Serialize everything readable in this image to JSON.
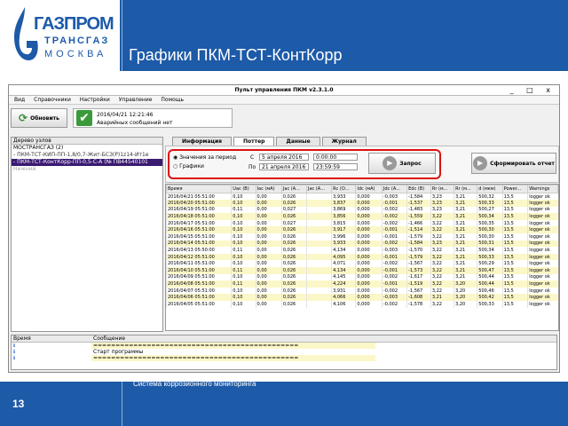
{
  "header": {
    "logo_main": "ГАЗПРОМ",
    "logo_sub1": "ТРАНСГАЗ",
    "logo_sub2": "МОСКВА",
    "slide_title": "Графики ПКМ-ТСТ-КонтКорр"
  },
  "window": {
    "title": "Пульт управления ПКМ v2.3.1.0",
    "controls": "_ □ x"
  },
  "menu": [
    "Вид",
    "Справочники",
    "Настройки",
    "Управление",
    "Помощь"
  ],
  "toolbar": {
    "refresh_label": "Обновить",
    "status_time": "2016/04/21 12:21:46",
    "status_msg": "Аварийных сообщений нет"
  },
  "tree": {
    "header": "Дерево узлов",
    "items": [
      "МОСТРАНСГАЗ (2)",
      "- ПКМ-ТСТ-КИП-ПП-1,8/0,7-Жит-БСЗ(Р)1z14-Ит1е",
      "- ПКМ-ТСТ-КонтКорр-ПП-0,5-С-А (№ ПВ44540101",
      "Нижний"
    ]
  },
  "tabs": [
    "Информация",
    "Поттер",
    "Данные",
    "Журнал"
  ],
  "query": {
    "radio1": "Значения за период",
    "radio2": "Графики",
    "from_label": "С",
    "to_label": "По",
    "from_date": "5  апреля  2016",
    "from_time": "0:00:00",
    "to_date": "21  апреля  2016",
    "to_time": "23:59:59",
    "query_button": "Запрос",
    "report_button": "Сформировать отчет"
  },
  "table": {
    "columns": [
      "Время",
      "Uac (В)",
      "Iac (мА)",
      "Jac (А...",
      "Jac (А...",
      "Rc (О...",
      "Idc (мА)",
      "Jdc (А...",
      "Edc (В)",
      "Rr (м...",
      "Rr (м...",
      "d (мкм)",
      "Power...",
      "Warnings"
    ],
    "rows": [
      [
        "2016/04/21 05:51:00",
        "0,10",
        "0,00",
        "0,026",
        "3,933",
        "0,000",
        "-0,003",
        "-1,584",
        "3,23",
        "3,21",
        "500,32",
        "13,5",
        "logger ok"
      ],
      [
        "2016/04/20 05:51:00",
        "0,10",
        "0,00",
        "0,026",
        "3,837",
        "0,000",
        "-0,001",
        "-1,537",
        "3,23",
        "3,21",
        "500,33",
        "13,5",
        "logger ok"
      ],
      [
        "2016/04/19 05:51:00",
        "0,11",
        "0,00",
        "0,027",
        "3,869",
        "0,000",
        "-0,002",
        "-1,483",
        "3,23",
        "3,21",
        "500,27",
        "13,5",
        "logger ok"
      ],
      [
        "2016/04/18 05:51:00",
        "0,10",
        "0,00",
        "0,026",
        "3,856",
        "0,000",
        "-0,002",
        "-1,559",
        "3,22",
        "3,21",
        "500,34",
        "13,5",
        "logger ok"
      ],
      [
        "2016/04/17 05:51:00",
        "0,10",
        "0,00",
        "0,027",
        "3,815",
        "0,000",
        "-0,002",
        "-1,466",
        "3,22",
        "3,21",
        "500,35",
        "13,5",
        "logger ok"
      ],
      [
        "2016/04/16 05:51:00",
        "0,10",
        "0,00",
        "0,026",
        "3,917",
        "0,000",
        "-0,001",
        "-1,514",
        "3,22",
        "3,21",
        "500,30",
        "13,5",
        "logger ok"
      ],
      [
        "2016/04/15 05:51:00",
        "0,10",
        "0,00",
        "0,026",
        "3,996",
        "0,000",
        "-0,001",
        "-1,579",
        "3,22",
        "3,21",
        "500,30",
        "13,5",
        "logger ok"
      ],
      [
        "2016/04/14 05:51:00",
        "0,10",
        "0,00",
        "0,026",
        "3,933",
        "0,000",
        "-0,002",
        "-1,584",
        "3,23",
        "3,21",
        "500,31",
        "13,5",
        "logger ok"
      ],
      [
        "2016/04/13 05:50:00",
        "0,11",
        "0,00",
        "0,026",
        "4,134",
        "0,000",
        "-0,003",
        "-1,570",
        "3,22",
        "3,21",
        "500,34",
        "13,5",
        "logger ok"
      ],
      [
        "2016/04/12 05:51:00",
        "0,10",
        "0,00",
        "0,026",
        "4,095",
        "0,000",
        "-0,001",
        "-1,579",
        "3,22",
        "3,21",
        "500,33",
        "13,5",
        "logger ok"
      ],
      [
        "2016/04/11 05:51:00",
        "0,10",
        "0,00",
        "0,026",
        "4,071",
        "0,000",
        "-0,002",
        "-1,567",
        "3,22",
        "3,21",
        "500,29",
        "13,5",
        "logger ok"
      ],
      [
        "2016/04/10 05:51:00",
        "0,11",
        "0,00",
        "0,026",
        "4,134",
        "0,000",
        "-0,001",
        "-1,573",
        "3,22",
        "3,21",
        "500,47",
        "13,5",
        "logger ok"
      ],
      [
        "2016/04/09 05:51:00",
        "0,10",
        "0,00",
        "0,026",
        "4,145",
        "0,000",
        "-0,002",
        "-1,617",
        "3,22",
        "3,21",
        "500,44",
        "13,5",
        "logger ok"
      ],
      [
        "2016/04/08 05:51:00",
        "0,11",
        "0,00",
        "0,026",
        "4,224",
        "0,000",
        "-0,001",
        "-1,519",
        "3,22",
        "3,20",
        "500,44",
        "13,5",
        "logger ok"
      ],
      [
        "2016/04/07 05:51:00",
        "0,10",
        "0,00",
        "0,026",
        "3,931",
        "0,000",
        "-0,002",
        "-1,567",
        "3,22",
        "3,20",
        "500,46",
        "13,5",
        "logger ok"
      ],
      [
        "2016/04/06 05:51:00",
        "0,10",
        "0,00",
        "0,026",
        "4,066",
        "0,000",
        "-0,003",
        "-1,608",
        "3,21",
        "3,20",
        "500,42",
        "13,5",
        "logger ok"
      ],
      [
        "2016/04/05 05:51:00",
        "0,10",
        "0,00",
        "0,026",
        "4,106",
        "0,000",
        "-0,002",
        "-1,578",
        "3,22",
        "3,20",
        "500,33",
        "13,5",
        "logger ok"
      ]
    ]
  },
  "log": {
    "col_time": "Время",
    "col_msg": "Сообщение",
    "lines": [
      "==============================================",
      "Старт программы",
      "=============================================="
    ]
  },
  "footer": {
    "page_number": "13",
    "caption": "Система коррозионного мониторинга"
  }
}
